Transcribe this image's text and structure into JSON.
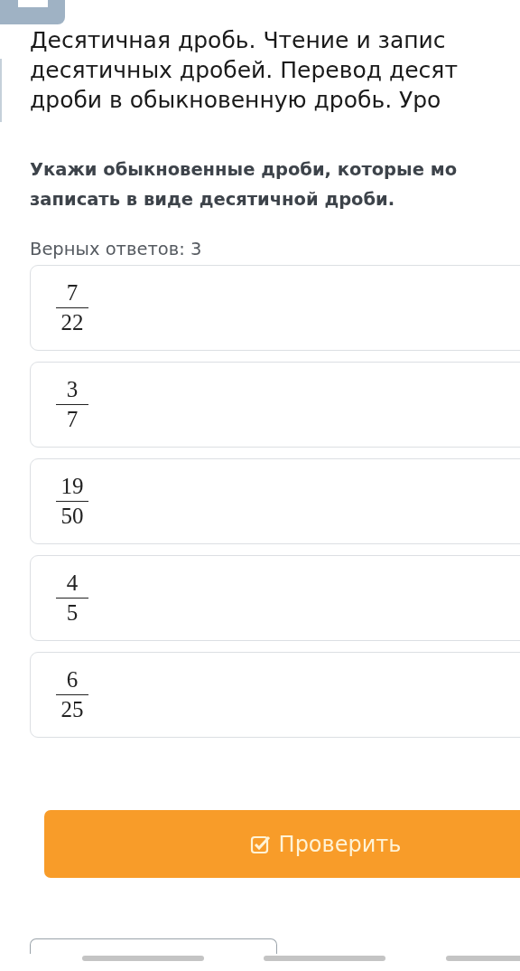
{
  "title_lines": [
    "Десятичная дробь. Чтение и запис",
    "десятичных дробей. Перевод десят",
    "дроби в обыкновенную дробь. Уро"
  ],
  "question_lines": [
    "Укажи обыкновенные дроби, которые мо",
    "записать в виде десятичной дроби."
  ],
  "answers_count": "Верных ответов: 3",
  "options": [
    {
      "numerator": "7",
      "denominator": "22"
    },
    {
      "numerator": "3",
      "denominator": "7"
    },
    {
      "numerator": "19",
      "denominator": "50"
    },
    {
      "numerator": "4",
      "denominator": "5"
    },
    {
      "numerator": "6",
      "denominator": "25"
    }
  ],
  "check_button": "Проверить"
}
